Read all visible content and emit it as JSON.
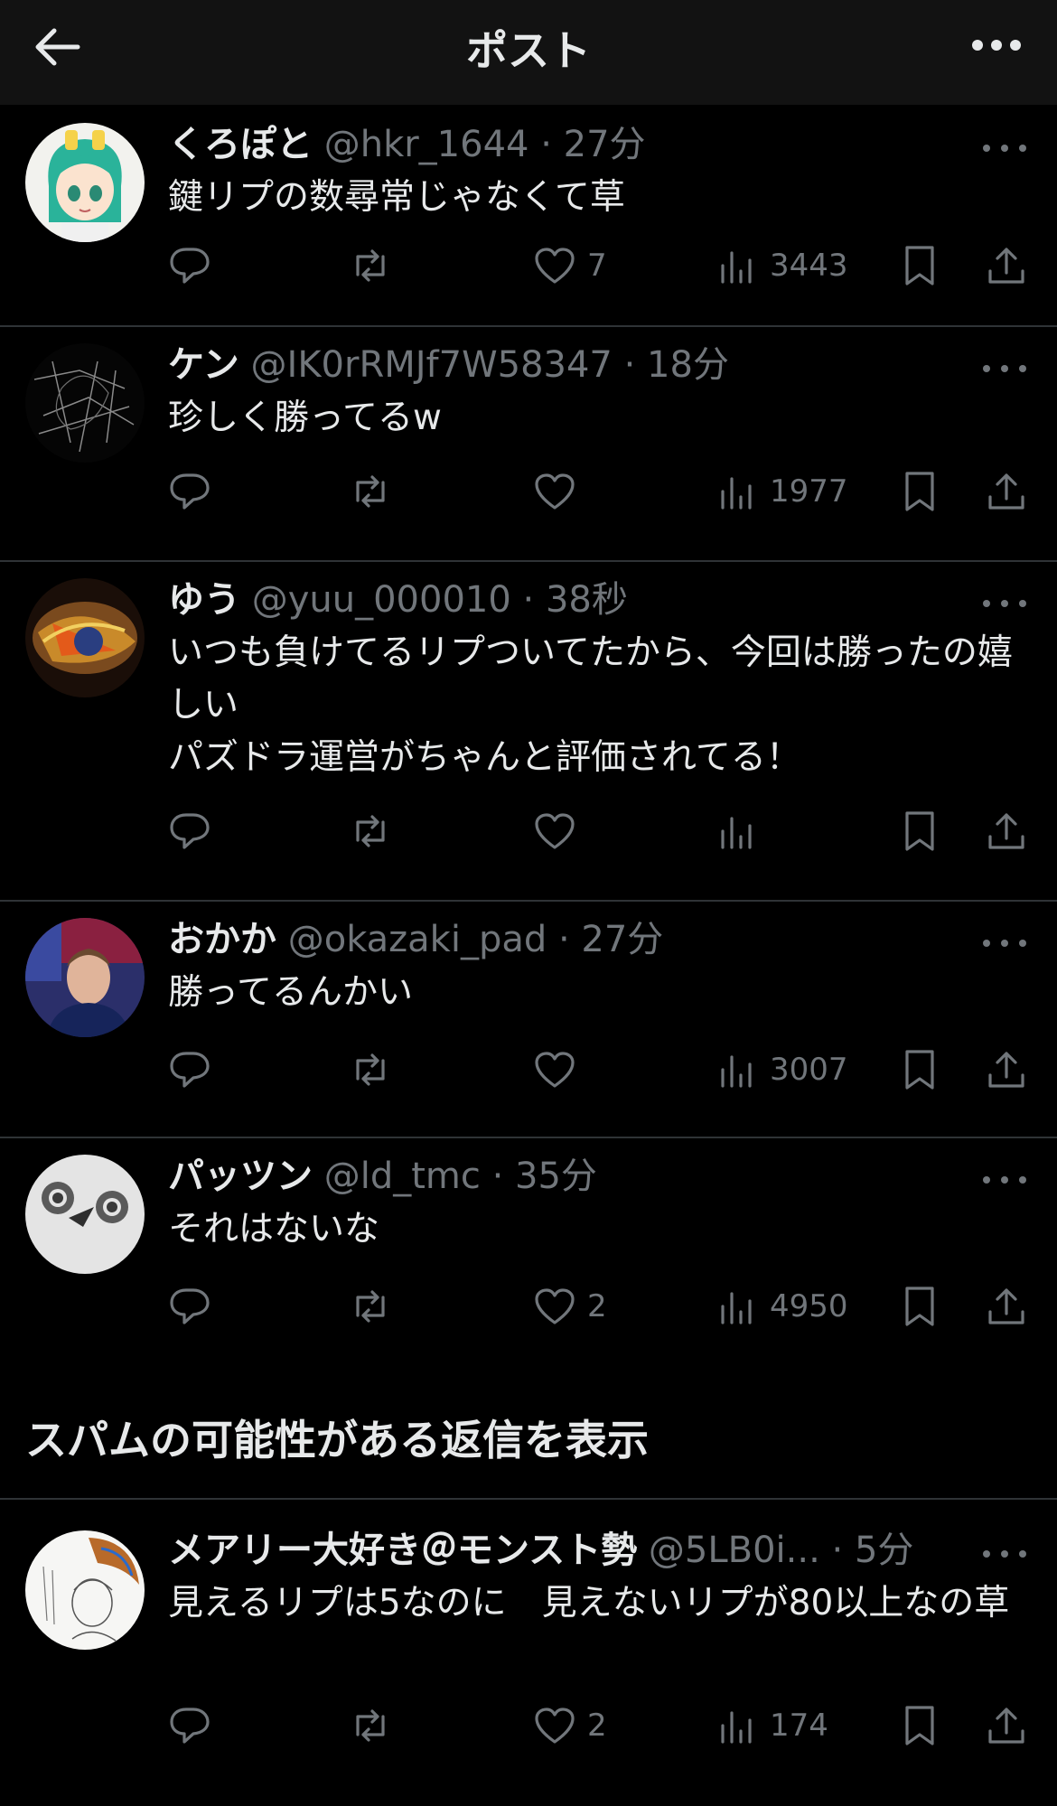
{
  "header": {
    "title": "ポスト"
  },
  "colors": {
    "background": "#000000",
    "header_bg": "#121212",
    "text": "#e7e9ea",
    "muted": "#71767b",
    "divider": "#2f3336"
  },
  "icons": [
    "back-arrow-icon",
    "more-dots-icon",
    "reply-icon",
    "retweet-icon",
    "like-icon",
    "views-icon",
    "bookmark-icon",
    "share-icon"
  ],
  "replies": [
    {
      "name": "くろぽと",
      "handle": "@hkr_1644",
      "dot": "·",
      "time": "27分",
      "text": "鍵リプの数尋常じゃなくて草",
      "likes": "7",
      "views": "3443"
    },
    {
      "name": "ケン",
      "handle": "@IK0rRMJf7W58347",
      "dot": "·",
      "time": "18分",
      "text": "珍しく勝ってるw",
      "likes": "",
      "views": "1977"
    },
    {
      "name": "ゆう",
      "handle": "@yuu_000010",
      "dot": "·",
      "time": "38秒",
      "text": "いつも負けてるリプついてたから、今回は勝ったの嬉しい\nパズドラ運営がちゃんと評価されてる！",
      "likes": "",
      "views": ""
    },
    {
      "name": "おかか",
      "handle": "@okazaki_pad",
      "dot": "·",
      "time": "27分",
      "text": "勝ってるんかい",
      "likes": "",
      "views": "3007"
    },
    {
      "name": "パッツン",
      "handle": "@ld_tmc",
      "dot": "·",
      "time": "35分",
      "text": "それはないな",
      "likes": "2",
      "views": "4950"
    }
  ],
  "spam_toggle": {
    "label": "スパムの可能性がある返信を表示"
  },
  "spam_replies": [
    {
      "name": "メアリー大好き＠モンスト勢",
      "handle": "@5LB0i...",
      "dot": "·",
      "time": "5分",
      "text": "見えるリプは5なのに　見えないリプが80以上なの草",
      "likes": "2",
      "views": "174"
    }
  ]
}
